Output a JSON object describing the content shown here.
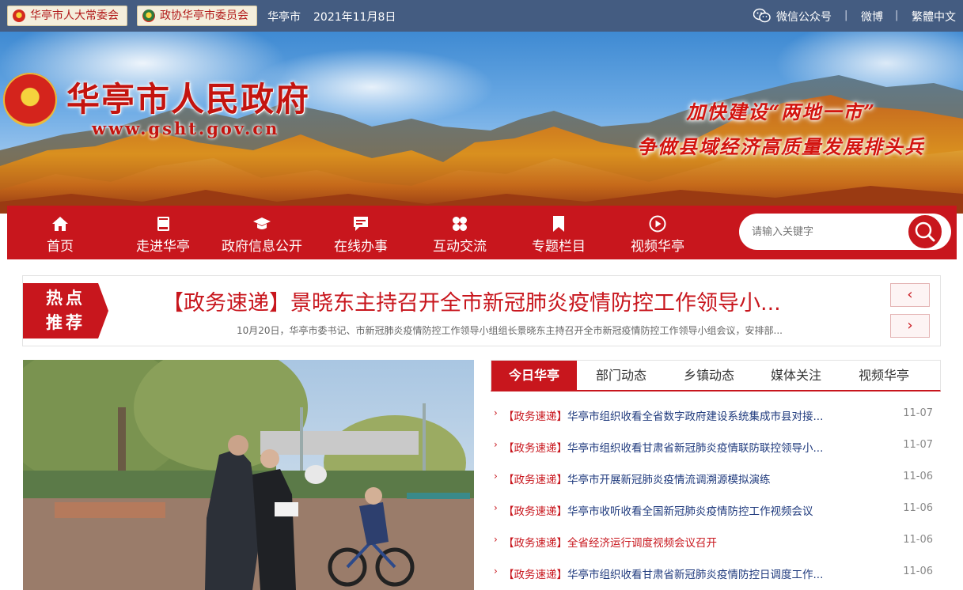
{
  "topbar": {
    "btn1": "华亭市人大常委会",
    "btn2": "政协华亭市委员会",
    "city": "华亭市",
    "date": "2021年11月8日",
    "wechat": "微信公众号",
    "weibo": "微博",
    "traditional": "繁體中文",
    "divider": "|"
  },
  "banner": {
    "title": "华亭市人民政府",
    "url": "www.gsht.gov.cn",
    "slogan1": "加快建设“两地一市”",
    "slogan2": "争做县域经济高质量发展排头兵"
  },
  "nav": {
    "items": [
      {
        "label": "首页",
        "icon": "home-icon"
      },
      {
        "label": "走进华亭",
        "icon": "book-icon"
      },
      {
        "label": "政府信息公开",
        "icon": "graduation-cap-icon"
      },
      {
        "label": "在线办事",
        "icon": "message-icon"
      },
      {
        "label": "互动交流",
        "icon": "clover-icon"
      },
      {
        "label": "专题栏目",
        "icon": "bookmark-icon"
      },
      {
        "label": "视频华亭",
        "icon": "play-icon"
      }
    ],
    "search_placeholder": "请输入关键字"
  },
  "hot": {
    "tag_line1": "热点",
    "tag_line2": "推荐",
    "title": "【政务速递】景晓东主持召开全市新冠肺炎疫情防控工作领导小...",
    "summary": "10月20日，华亭市委书记、市新冠肺炎疫情防控工作领导小组组长景晓东主持召开全市新冠疫情防控工作领导小组会议，安排部...",
    "prev": "‹",
    "next": "›"
  },
  "tabs": [
    "今日华亭",
    "部门动态",
    "乡镇动态",
    "媒体关注",
    "视频华亭"
  ],
  "news": [
    {
      "tag": "【政务速递】",
      "title": "华亭市组织收看全省数字政府建设系统集成市县对接...",
      "date": "11-07"
    },
    {
      "tag": "【政务速递】",
      "title": "华亭市组织收看甘肃省新冠肺炎疫情联防联控领导小...",
      "date": "11-07"
    },
    {
      "tag": "【政务速递】",
      "title": "华亭市开展新冠肺炎疫情流调溯源模拟演练",
      "date": "11-06"
    },
    {
      "tag": "【政务速递】",
      "title": "华亭市收听收看全国新冠肺炎疫情防控工作视频会议",
      "date": "11-06"
    },
    {
      "tag": "【政务速递】",
      "title": "全省经济运行调度视频会议召开",
      "date": "11-06"
    },
    {
      "tag": "【政务速递】",
      "title": "华亭市组织收看甘肃省新冠肺炎疫情防控日调度工作...",
      "date": "11-06"
    }
  ],
  "colors": {
    "brand_red": "#c8161d",
    "link_blue": "#1f3a7d",
    "topbar": "#344e76"
  }
}
